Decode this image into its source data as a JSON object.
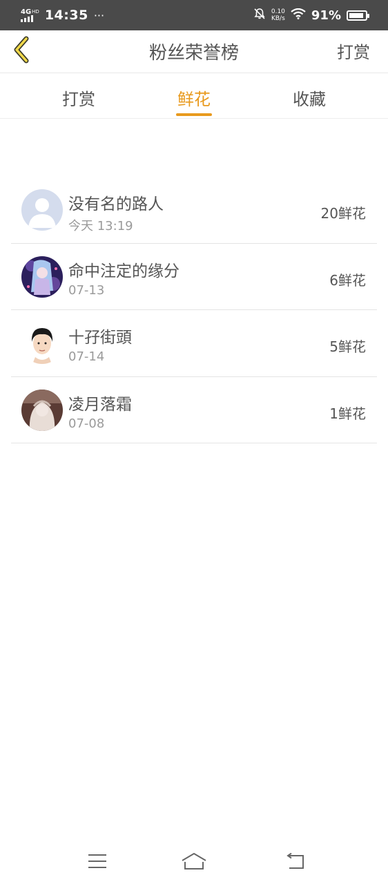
{
  "status_bar": {
    "network": "4G",
    "network_sup": "HD",
    "time": "14:35",
    "more": "···",
    "speed_value": "0.10",
    "speed_unit": "KB/s",
    "battery_percent": "91%",
    "battery_level": 0.91
  },
  "header": {
    "title": "粉丝荣誉榜",
    "right_action": "打赏"
  },
  "tabs": {
    "items": [
      {
        "label": "打赏"
      },
      {
        "label": "鲜花"
      },
      {
        "label": "收藏"
      }
    ],
    "active_index": 1,
    "accent_color": "#e89a1e"
  },
  "list": {
    "rows": [
      {
        "name": "没有名的路人",
        "time": "今天 13:19",
        "amount": "20鲜花",
        "avatar": "default-user-avatar"
      },
      {
        "name": "命中注定的缘分",
        "time": "07-13",
        "amount": "6鲜花",
        "avatar": "anime-girl-avatar"
      },
      {
        "name": "十孖街頭",
        "time": "07-14",
        "amount": "5鲜花",
        "avatar": "short-hair-person-avatar"
      },
      {
        "name": "凌月落霜",
        "time": "07-08",
        "amount": "1鲜花",
        "avatar": "pale-figure-avatar"
      }
    ]
  },
  "navbar": {
    "icons": [
      "menu-icon",
      "home-icon",
      "back-icon"
    ]
  }
}
